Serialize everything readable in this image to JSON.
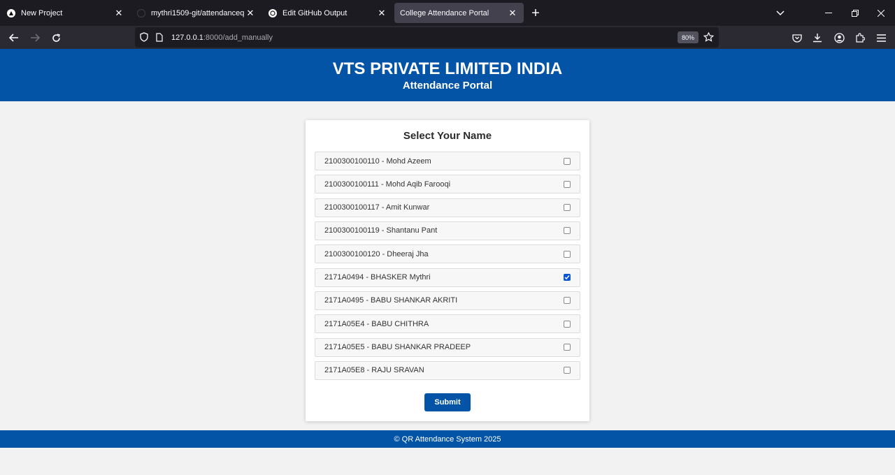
{
  "browser": {
    "tabs": [
      {
        "title": "New Project",
        "icon": "triangle-icon",
        "active": false
      },
      {
        "title": "mythri1509-git/attendanceqr",
        "icon": "github-icon",
        "active": false
      },
      {
        "title": "Edit GitHub Output",
        "icon": "openai-icon",
        "active": false
      },
      {
        "title": "College Attendance Portal",
        "icon": "",
        "active": true
      }
    ],
    "url": {
      "host": "127.0.0.1",
      "rest": ":8000/add_manually"
    },
    "zoom": "80%"
  },
  "header": {
    "title": "VTS PRIVATE LIMITED INDIA",
    "subtitle": "Attendance Portal"
  },
  "form": {
    "title": "Select Your Name",
    "students": [
      {
        "label": "2100300100110 - Mohd Azeem",
        "checked": false
      },
      {
        "label": "2100300100111 - Mohd Aqib Farooqi",
        "checked": false
      },
      {
        "label": "2100300100117 - Amit Kunwar",
        "checked": false
      },
      {
        "label": "2100300100119 - Shantanu Pant",
        "checked": false
      },
      {
        "label": "2100300100120 - Dheeraj Jha",
        "checked": false
      },
      {
        "label": "2171A0494 - BHASKER Mythri",
        "checked": true
      },
      {
        "label": "2171A0495 - BABU SHANKAR AKRITI",
        "checked": false
      },
      {
        "label": "2171A05E4 - BABU CHITHRA",
        "checked": false
      },
      {
        "label": "2171A05E5 - BABU SHANKAR PRADEEP",
        "checked": false
      },
      {
        "label": "2171A05E8 - RAJU SRAVAN",
        "checked": false
      }
    ],
    "submit_label": "Submit"
  },
  "footer": {
    "text": "© QR Attendance System 2025"
  },
  "colors": {
    "brand": "#0354a6",
    "checkbox_checked": "#0b57d0"
  }
}
